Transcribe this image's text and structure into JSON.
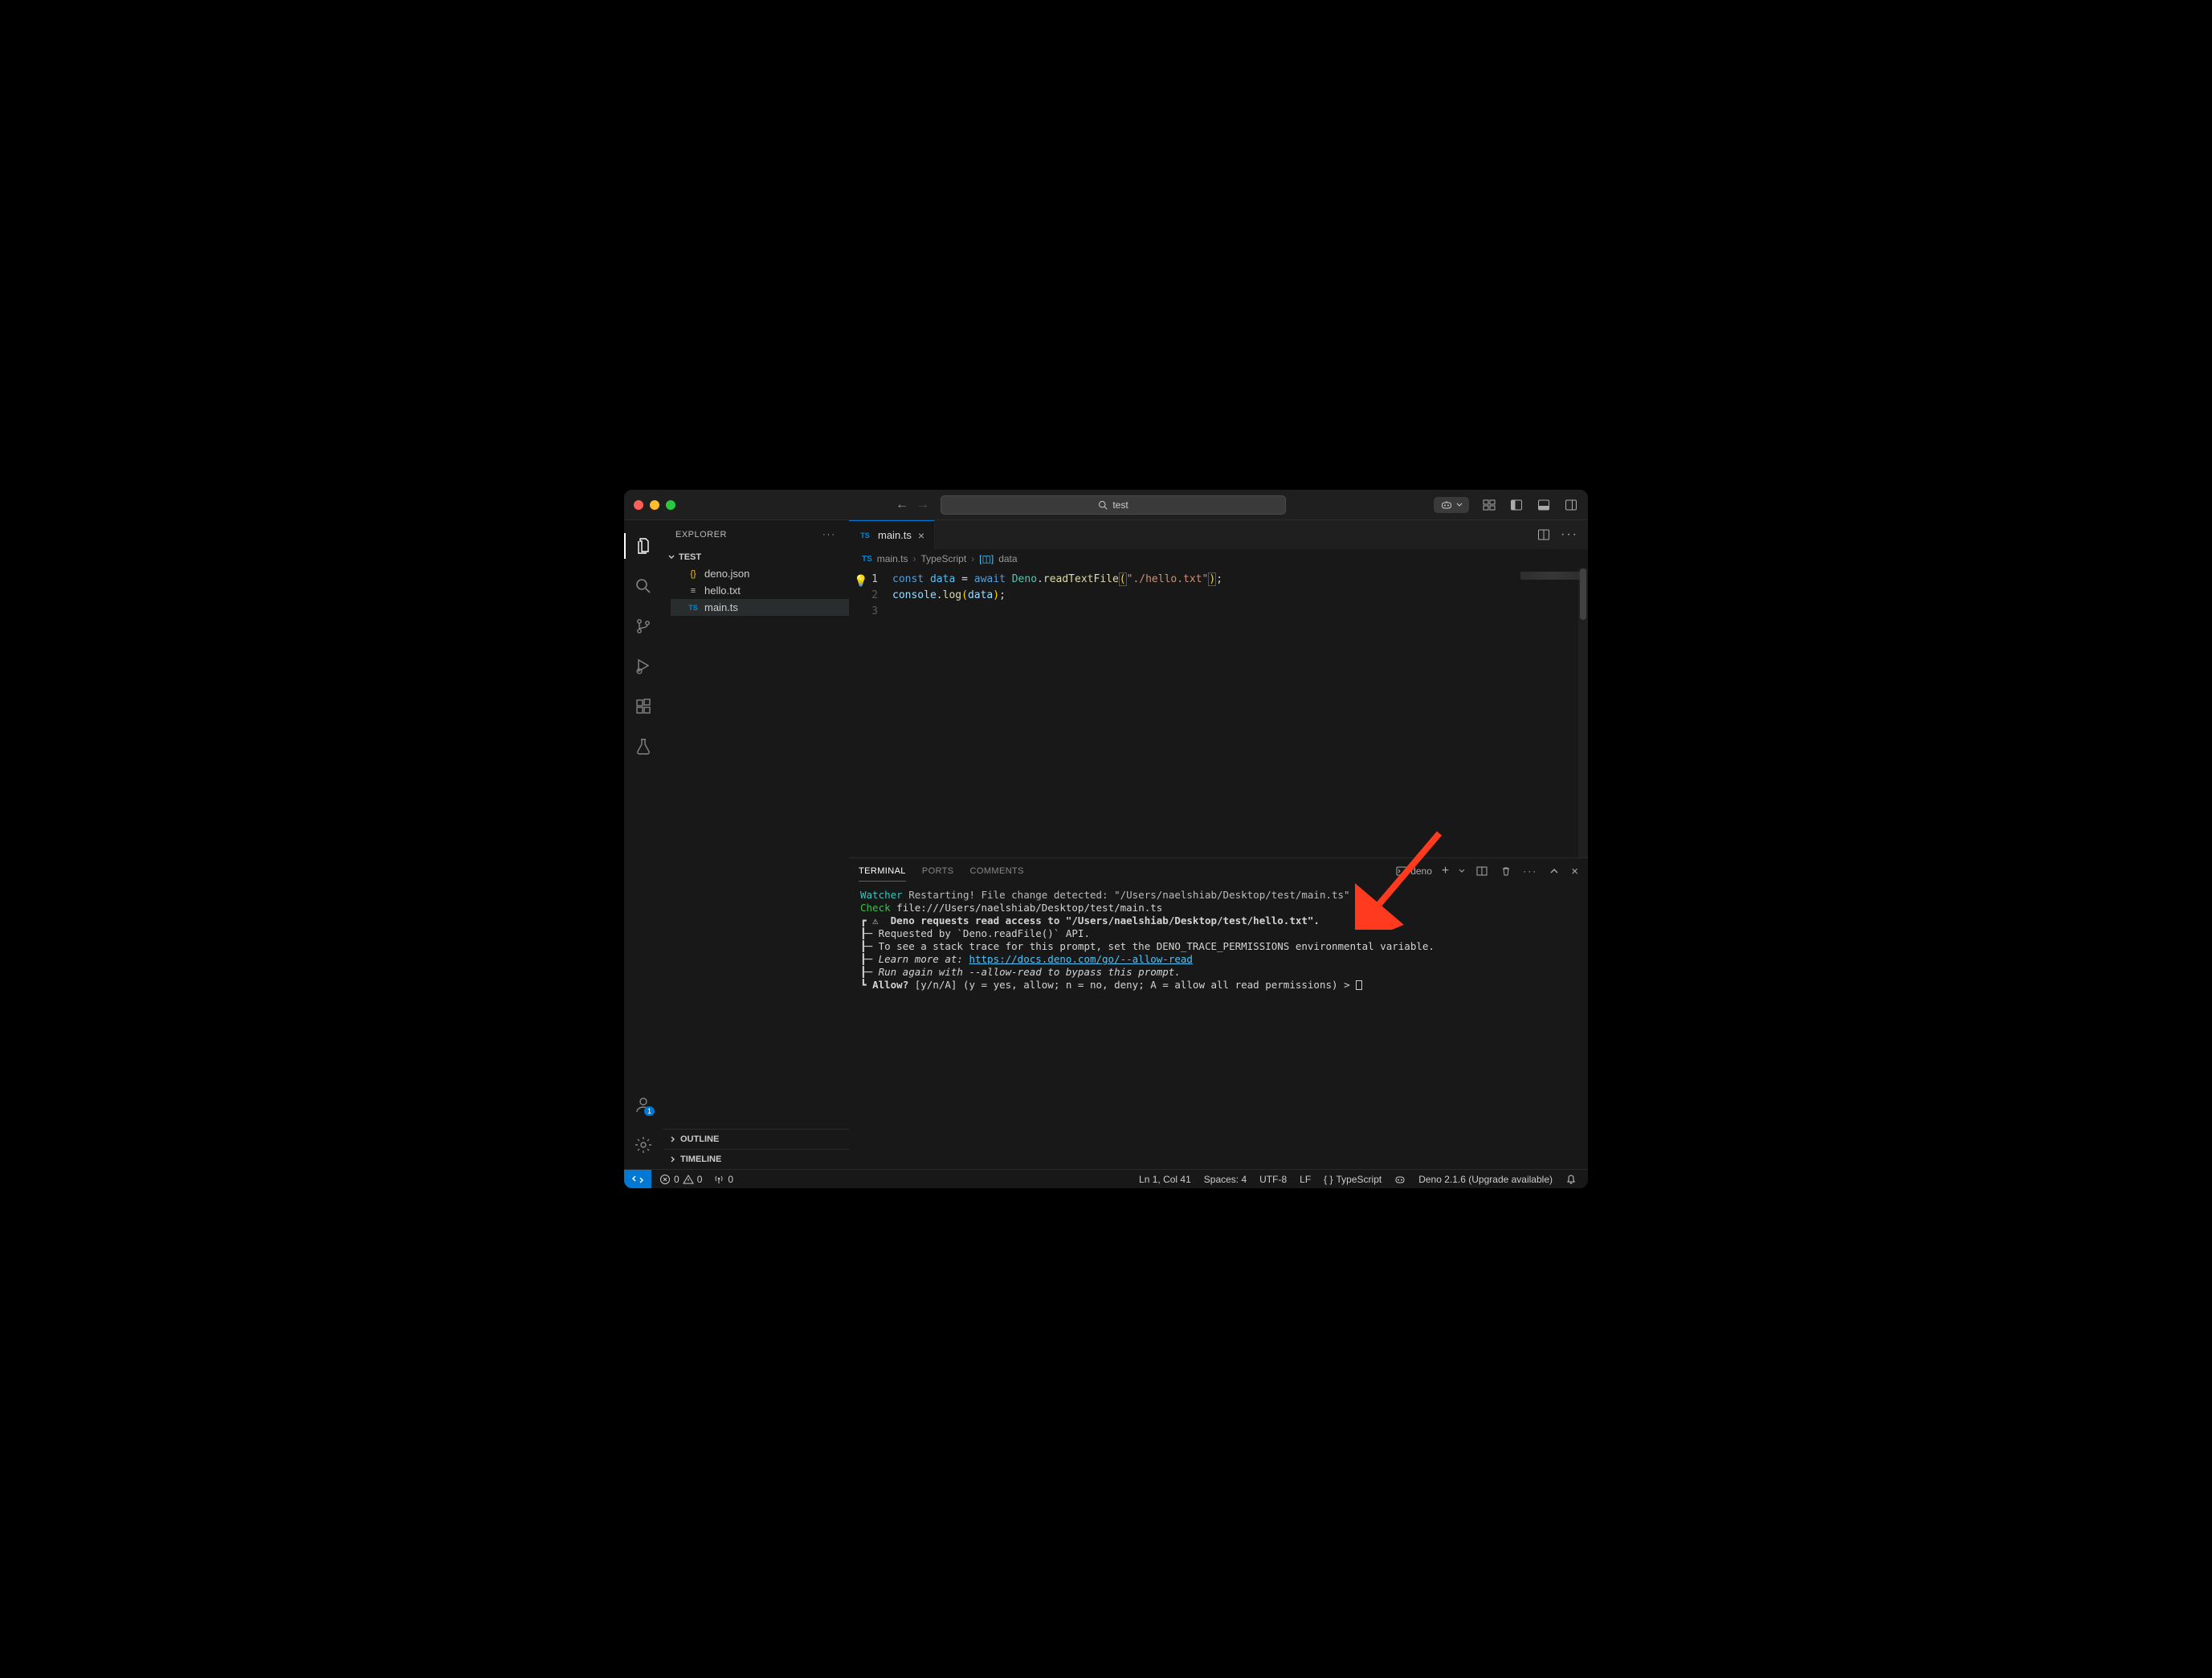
{
  "titlebar": {
    "search_placeholder": "test"
  },
  "sidebar": {
    "title": "EXPLORER",
    "folder": "TEST",
    "files": [
      {
        "icon": "{}",
        "name": "deno.json",
        "cls": "fi-json"
      },
      {
        "icon": "≡",
        "name": "hello.txt",
        "cls": "fi-txt"
      },
      {
        "icon": "TS",
        "name": "main.ts",
        "cls": "fi-ts",
        "active": true
      }
    ],
    "outline": "OUTLINE",
    "timeline": "TIMELINE"
  },
  "tab": {
    "icon": "TS",
    "name": "main.ts"
  },
  "breadcrumb": {
    "file": "main.ts",
    "lang": "TypeScript",
    "symbol": "data"
  },
  "code": {
    "line1": {
      "kw": "const",
      "var": "data",
      "eq": " = ",
      "await": "await",
      "sp": " ",
      "obj": "Deno",
      "dot": ".",
      "fn": "readTextFile",
      "po": "(",
      "str": "\"./hello.txt\"",
      "pc": ")",
      "semi": ";"
    },
    "line2": {
      "obj": "console",
      "dot": ".",
      "fn": "log",
      "po": "(",
      "var": "data",
      "pc": ")",
      "semi": ";"
    }
  },
  "panel": {
    "tabs": {
      "terminal": "TERMINAL",
      "ports": "PORTS",
      "comments": "COMMENTS"
    },
    "shell": "deno"
  },
  "terminal": {
    "watcher": "Watcher",
    "restart": " Restarting! File change detected: \"/Users/naelshiab/Desktop/test/main.ts\"",
    "check": "Check",
    "checkpath": " file:///Users/naelshiab/Desktop/test/main.ts",
    "warn": "┏ ⚠  ",
    "req": "Deno requests read access to \"/Users/naelshiab/Desktop/test/hello.txt\".",
    "l1": "┠─ Requested by `Deno.readFile()` API.",
    "l2": "┠─ To see a stack trace for this prompt, set the DENO_TRACE_PERMISSIONS environmental variable.",
    "l3a": "┠─ ",
    "l3i": "Learn more at: ",
    "l3link": "https://docs.deno.com/go/--allow-read",
    "l4": "┠─ ",
    "l4i": "Run again with --allow-read to bypass this prompt.",
    "l5a": "┗ ",
    "l5b": "Allow?",
    "l5c": " [y/n/A] (y = yes, allow; n = no, deny; A = allow all read permissions) > "
  },
  "statusbar": {
    "errors": "0",
    "warnings": "0",
    "ports": "0",
    "cursor": "Ln 1, Col 41",
    "spaces": "Spaces: 4",
    "encoding": "UTF-8",
    "eol": "LF",
    "lang": "TypeScript",
    "deno": "Deno 2.1.6 (Upgrade available)"
  },
  "accounts_badge": "1"
}
